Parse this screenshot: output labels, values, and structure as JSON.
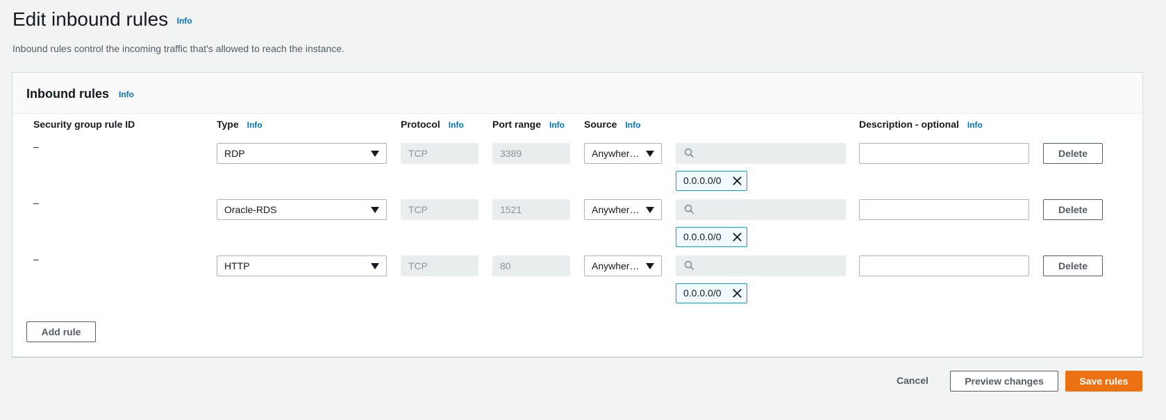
{
  "page": {
    "title": "Edit inbound rules",
    "info": "Info",
    "description": "Inbound rules control the incoming traffic that's allowed to reach the instance."
  },
  "panel": {
    "title": "Inbound rules",
    "info": "Info"
  },
  "columns": {
    "rule_id": "Security group rule ID",
    "type": "Type",
    "protocol": "Protocol",
    "port_range": "Port range",
    "source": "Source",
    "description": "Description - optional",
    "info": "Info"
  },
  "rules": [
    {
      "rule_id": "–",
      "type": "RDP",
      "protocol": "TCP",
      "port_range": "3389",
      "source": "Anywher…",
      "search_value": "",
      "token": "0.0.0.0/0",
      "description": "",
      "delete_label": "Delete"
    },
    {
      "rule_id": "–",
      "type": "Oracle-RDS",
      "protocol": "TCP",
      "port_range": "1521",
      "source": "Anywher…",
      "search_value": "",
      "token": "0.0.0.0/0",
      "description": "",
      "delete_label": "Delete"
    },
    {
      "rule_id": "–",
      "type": "HTTP",
      "protocol": "TCP",
      "port_range": "80",
      "source": "Anywher…",
      "search_value": "",
      "token": "0.0.0.0/0",
      "description": "",
      "delete_label": "Delete"
    }
  ],
  "actions": {
    "add_rule": "Add rule",
    "cancel": "Cancel",
    "preview": "Preview changes",
    "save": "Save rules"
  },
  "colors": {
    "primary": "#ec7211",
    "link": "#0073bb",
    "token_border": "#00a1c9"
  },
  "icons": {
    "search": "search-icon",
    "remove": "close-icon",
    "dropdown": "caret-down-icon"
  }
}
